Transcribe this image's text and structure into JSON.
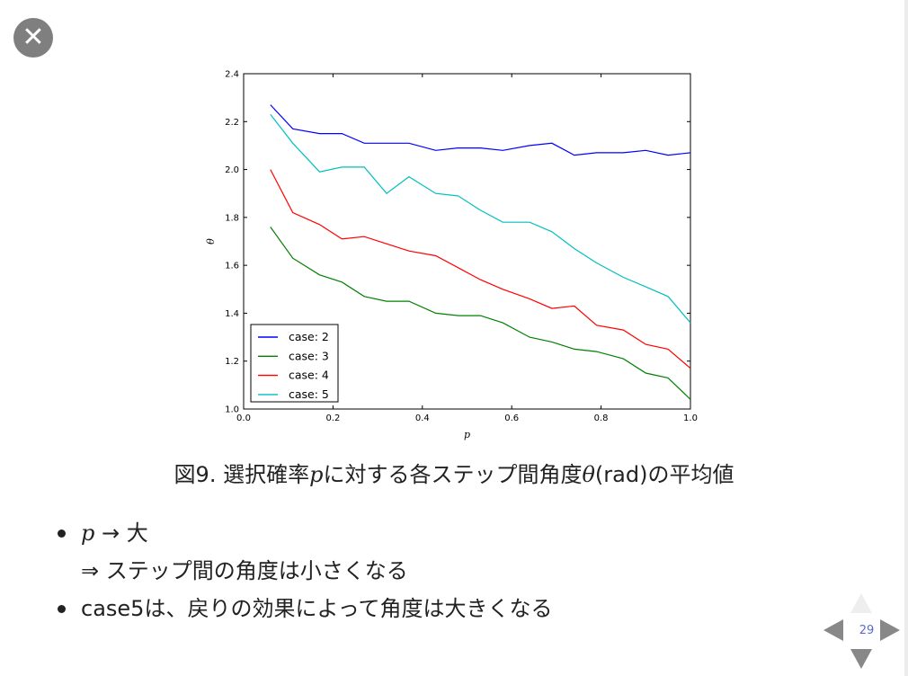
{
  "caption": {
    "prefix": "図9. 選択確率",
    "var_p": "p",
    "middle": "に対する各ステップ間角度",
    "var_theta": "θ",
    "suffix": "(rad)の平均値"
  },
  "bullets": {
    "item1_var": "p",
    "item1_arrow": "→",
    "item1_text": "大",
    "item1_implies": "⇒",
    "item1_sub": "ステップ間の角度は小さくなる",
    "item2_text": "case5は、戻りの効果によって角度は大きくなる"
  },
  "nav": {
    "page_number": "29"
  },
  "icons": {
    "close": "close-icon",
    "prev": "arrow-left-icon",
    "next": "arrow-right-icon",
    "up": "arrow-up-icon",
    "down": "arrow-down-icon"
  },
  "chart_data": {
    "type": "line",
    "xlabel": "p",
    "ylabel": "θ",
    "xlim": [
      0.0,
      1.0
    ],
    "ylim": [
      1.0,
      2.4
    ],
    "xticks": [
      "0.0",
      "0.2",
      "0.4",
      "0.6",
      "0.8",
      "1.0"
    ],
    "yticks": [
      "1.0",
      "1.2",
      "1.4",
      "1.6",
      "1.8",
      "2.0",
      "2.2",
      "2.4"
    ],
    "legend_position": "lower-left",
    "grid": false,
    "x": [
      0.06,
      0.11,
      0.17,
      0.22,
      0.27,
      0.32,
      0.37,
      0.43,
      0.48,
      0.53,
      0.58,
      0.64,
      0.69,
      0.74,
      0.79,
      0.85,
      0.9,
      0.95,
      1.0
    ],
    "series": [
      {
        "name": "case: 2",
        "color": "#0000ff",
        "values": [
          2.27,
          2.17,
          2.15,
          2.15,
          2.11,
          2.11,
          2.11,
          2.08,
          2.09,
          2.09,
          2.08,
          2.1,
          2.11,
          2.06,
          2.07,
          2.07,
          2.08,
          2.06,
          2.07
        ]
      },
      {
        "name": "case: 3",
        "color": "#008000",
        "values": [
          1.76,
          1.63,
          1.56,
          1.53,
          1.47,
          1.45,
          1.45,
          1.4,
          1.39,
          1.39,
          1.36,
          1.3,
          1.28,
          1.25,
          1.24,
          1.21,
          1.15,
          1.13,
          1.04
        ]
      },
      {
        "name": "case: 4",
        "color": "#ff0000",
        "values": [
          2.0,
          1.82,
          1.77,
          1.71,
          1.72,
          1.69,
          1.66,
          1.64,
          1.59,
          1.54,
          1.5,
          1.46,
          1.42,
          1.43,
          1.35,
          1.33,
          1.27,
          1.25,
          1.17
        ]
      },
      {
        "name": "case: 5",
        "color": "#00bfbf",
        "values": [
          2.23,
          2.11,
          1.99,
          2.01,
          2.01,
          1.9,
          1.97,
          1.9,
          1.89,
          1.83,
          1.78,
          1.78,
          1.74,
          1.67,
          1.61,
          1.55,
          1.51,
          1.47,
          1.36
        ]
      }
    ]
  }
}
